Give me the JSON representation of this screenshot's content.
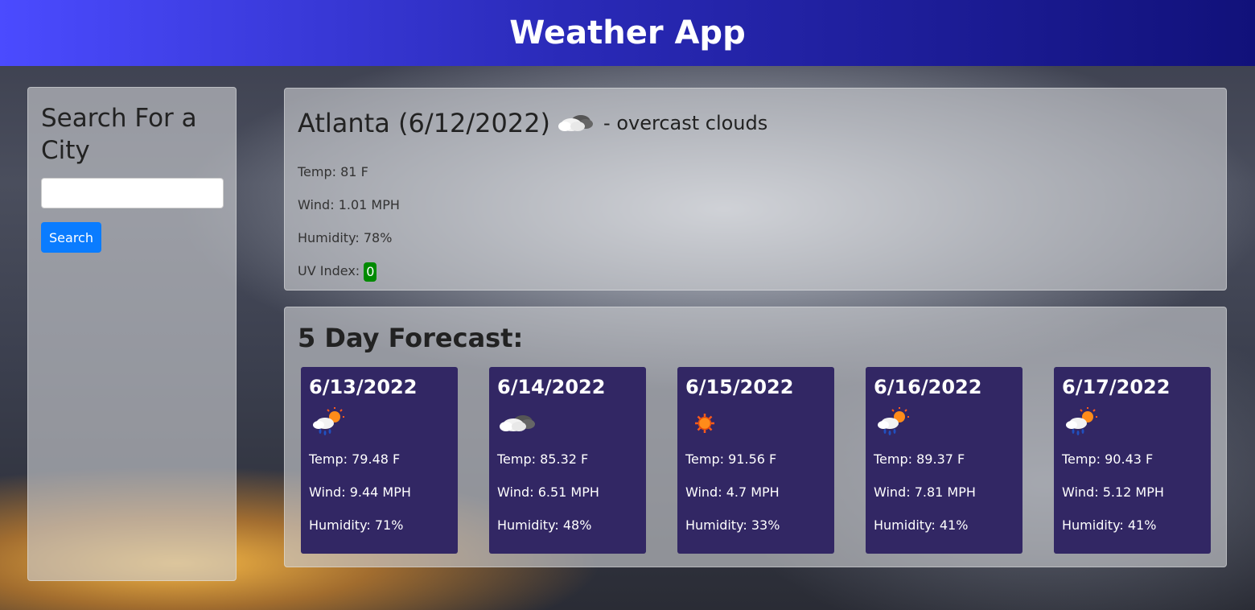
{
  "header": {
    "title": "Weather App"
  },
  "search": {
    "title": "Search For a City",
    "input_value": "",
    "button_label": "Search"
  },
  "current": {
    "city_date": "Atlanta (6/12/2022)",
    "icon": "overcast-clouds-icon",
    "description": "- overcast clouds",
    "temp": "Temp: 81 F",
    "wind": "Wind: 1.01 MPH",
    "humidity": "Humidity: 78%",
    "uv_label": "UV Index:",
    "uv_value": "0",
    "uv_color": "#008a00"
  },
  "forecast": {
    "title": "5 Day Forecast:",
    "days": [
      {
        "date": "6/13/2022",
        "icon": "rain-sun-icon",
        "temp": "Temp: 79.48 F",
        "wind": "Wind: 9.44 MPH",
        "humidity": "Humidity: 71%"
      },
      {
        "date": "6/14/2022",
        "icon": "cloud-icon",
        "temp": "Temp: 85.32 F",
        "wind": "Wind: 6.51 MPH",
        "humidity": "Humidity: 48%"
      },
      {
        "date": "6/15/2022",
        "icon": "sun-icon",
        "temp": "Temp: 91.56 F",
        "wind": "Wind: 4.7 MPH",
        "humidity": "Humidity: 33%"
      },
      {
        "date": "6/16/2022",
        "icon": "rain-sun-icon",
        "temp": "Temp: 89.37 F",
        "wind": "Wind: 7.81 MPH",
        "humidity": "Humidity: 41%"
      },
      {
        "date": "6/17/2022",
        "icon": "rain-sun-icon",
        "temp": "Temp: 90.43 F",
        "wind": "Wind: 5.12 MPH",
        "humidity": "Humidity: 41%"
      }
    ]
  },
  "colors": {
    "header_gradient_start": "#4b4bff",
    "header_gradient_end": "#11117a",
    "card_bg": "#322764",
    "button_bg": "#0a7cff"
  }
}
